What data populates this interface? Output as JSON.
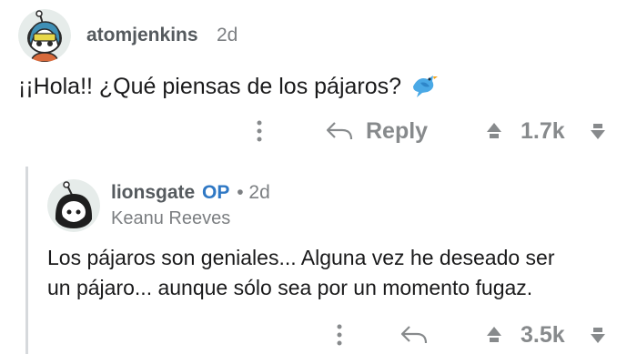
{
  "comment1": {
    "username": "atomjenkins",
    "age": "2d",
    "text": "¡¡Hola!! ¿Qué piensas de los pájaros?",
    "bird_emoji": "bird-icon",
    "reply_label": "Reply",
    "score": "1.7k"
  },
  "comment2": {
    "username": "lionsgate",
    "op_badge": "OP",
    "separator": "•",
    "age": "2d",
    "flair": "Keanu Reeves",
    "text_line1": "Los pájaros son geniales... Alguna vez he deseado ser",
    "text_line2": "un pájaro... aunque sólo sea por un momento fugaz.",
    "score": "3.5k"
  },
  "colors": {
    "username": "#555a5e",
    "op": "#2f78c4",
    "meta": "#7c7f82",
    "action": "#878a8c",
    "bird": "#4aa9e6"
  }
}
